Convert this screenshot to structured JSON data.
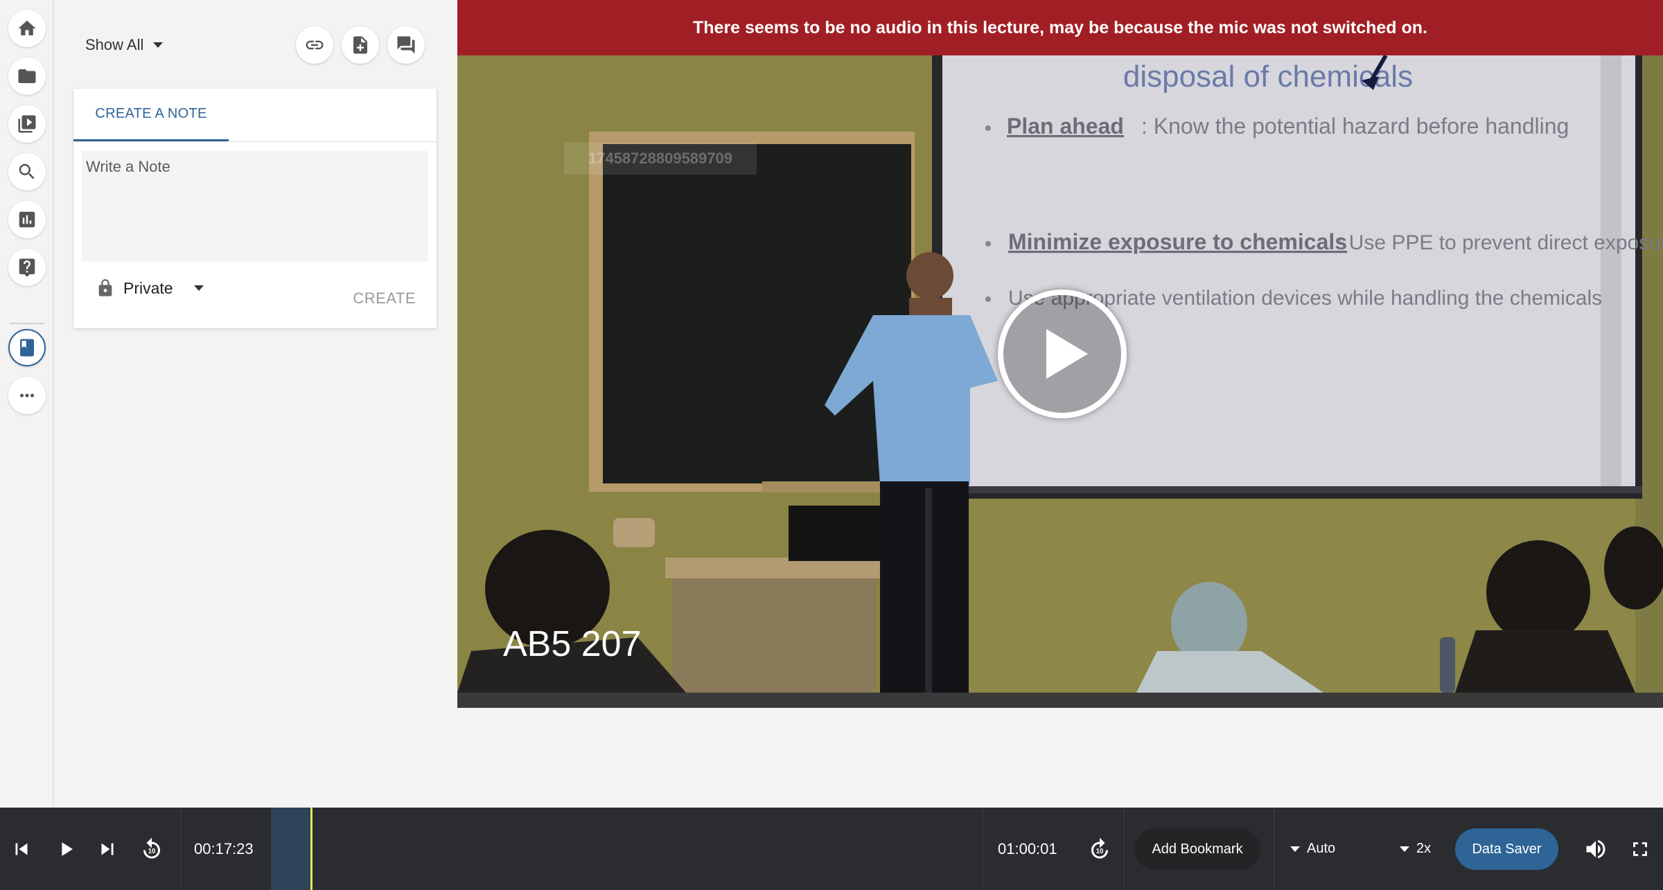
{
  "notes": {
    "filter_label": "Show All",
    "tab_label": "CREATE A NOTE",
    "note_placeholder": "Write a Note",
    "privacy_label": "Private",
    "create_label": "CREATE"
  },
  "video": {
    "banner_text": "There seems to be no audio in this lecture, may be because the mic was not switched on.",
    "watermark_id": "17458728809589709",
    "room_label": "AB5 207",
    "slide_title": "disposal of chemicals",
    "slide_item_1_heading": "Plan ahead",
    "slide_item_1_text": ": Know the potential hazard before handling",
    "slide_item_2_heading": "Minimize exposure to chemicals",
    "slide_item_2_text": ": Use PPE to prevent direct exposure to skin, eye;",
    "slide_item_3_text": "Use appropriate ventilation devices while handling the chemicals"
  },
  "player": {
    "current_time": "00:17:23",
    "duration": "01:00:01",
    "progress_fraction": 0.0373,
    "bookmark_label": "Add Bookmark",
    "quality_value": "Auto",
    "speed_value": "2x",
    "data_saver_label": "Data Saver",
    "rewind_seconds": "10",
    "forward_seconds": "10"
  },
  "colors": {
    "accent": "#2e6496",
    "banner": "#a11f24",
    "progress_head": "#e6e84c"
  },
  "icons": {
    "rail": [
      "home-icon",
      "folder-icon",
      "video-library-icon",
      "search-icon",
      "analytics-icon",
      "help-icon",
      "bookmark-icon",
      "more-icon"
    ],
    "panel": [
      "link-icon",
      "add-file-icon",
      "forum-icon"
    ]
  }
}
